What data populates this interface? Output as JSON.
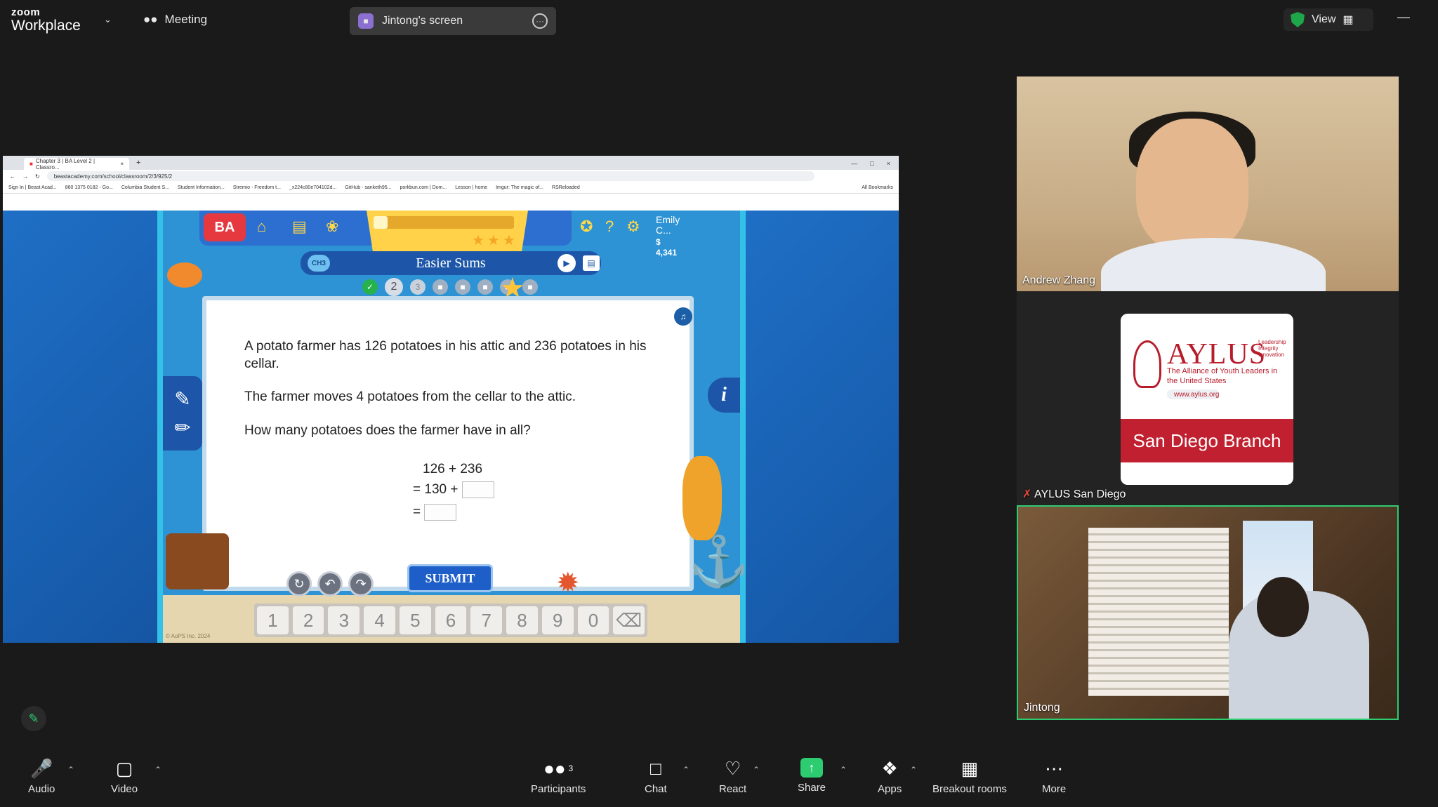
{
  "app": {
    "brand_small": "zoom",
    "brand_big": "Workplace",
    "meeting_label": "Meeting"
  },
  "screen_share": {
    "label": "Jintong's screen"
  },
  "view": {
    "label": "View"
  },
  "browser": {
    "tab_title": "Chapter 3 | BA Level 2 | Classro...",
    "url": "beastacademy.com/school/classroom/2/3/925/2",
    "bookmarks": [
      "Sign In | Beast Acad...",
      "860 1375 0182 - Go...",
      "Columbia Student S...",
      "Student Information...",
      "Stremio - Freedom t...",
      "_x224c80e704102d...",
      "GitHub - sanketh95...",
      "porkbun.com | Dom...",
      "Lesson | home",
      "Imgur: The magic of...",
      "RSReloaded",
      "All Bookmarks"
    ]
  },
  "game": {
    "logo": "BA",
    "user_name": "Emily C...",
    "user_coins": "$ 4,341",
    "progress": 0.1,
    "chapter_badge": "CH3",
    "lesson_title": "Easier Sums",
    "steps": [
      "2",
      "3"
    ],
    "question": [
      "A potato farmer has 126 potatoes in his attic and 236 potatoes in his cellar.",
      "The farmer moves 4 potatoes from the cellar to the attic.",
      "How many potatoes does the farmer have in all?"
    ],
    "eq1": "126 + 236",
    "eq2": "= 130 +",
    "eq3": "=",
    "submit": "SUBMIT",
    "keys": [
      "1",
      "2",
      "3",
      "4",
      "5",
      "6",
      "7",
      "8",
      "9",
      "0"
    ],
    "copyright": "© AoPS Inc. 2024"
  },
  "participants": [
    {
      "name": "Andrew Zhang"
    },
    {
      "name": "AYLUS San Diego",
      "logo_big": "AYLUS",
      "logo_line": "The Alliance of Youth Leaders in the United States",
      "logo_url": "www.aylus.org",
      "logo_tags": "Leadership Integrity Innovation",
      "branch": "San Diego Branch"
    },
    {
      "name": "Jintong"
    }
  ],
  "toolbar": {
    "audio": "Audio",
    "video": "Video",
    "participants": "Participants",
    "participants_count": "3",
    "chat": "Chat",
    "react": "React",
    "share": "Share",
    "apps": "Apps",
    "breakout": "Breakout rooms",
    "more": "More"
  }
}
